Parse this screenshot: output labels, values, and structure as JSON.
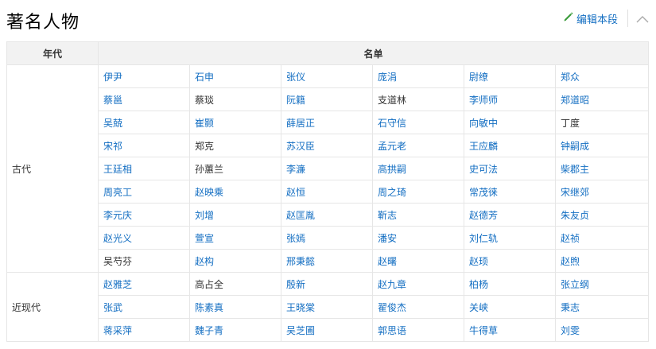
{
  "section": {
    "title": "著名人物",
    "edit_label": "编辑本段"
  },
  "table": {
    "headers": [
      "年代",
      "名单"
    ],
    "groups": [
      {
        "era": "古代",
        "rows": [
          [
            {
              "n": "伊尹",
              "l": true
            },
            {
              "n": "石申",
              "l": true
            },
            {
              "n": "张仪",
              "l": true
            },
            {
              "n": "庞涓",
              "l": true
            },
            {
              "n": "尉缭",
              "l": true
            },
            {
              "n": "郑众",
              "l": true
            }
          ],
          [
            {
              "n": "蔡邕",
              "l": true
            },
            {
              "n": "蔡琰",
              "l": false
            },
            {
              "n": "阮籍",
              "l": true
            },
            {
              "n": "支道林",
              "l": false
            },
            {
              "n": "李师师",
              "l": true
            },
            {
              "n": "郑道昭",
              "l": true
            }
          ],
          [
            {
              "n": "吴兢",
              "l": true
            },
            {
              "n": "崔颢",
              "l": true
            },
            {
              "n": "薛居正",
              "l": true
            },
            {
              "n": "石守信",
              "l": true
            },
            {
              "n": "向敏中",
              "l": true
            },
            {
              "n": "丁度",
              "l": false
            }
          ],
          [
            {
              "n": "宋祁",
              "l": true
            },
            {
              "n": "郑克",
              "l": false
            },
            {
              "n": "苏汉臣",
              "l": true
            },
            {
              "n": "孟元老",
              "l": true
            },
            {
              "n": "王应麟",
              "l": true
            },
            {
              "n": "钟嗣成",
              "l": true
            }
          ],
          [
            {
              "n": "王廷相",
              "l": true
            },
            {
              "n": "孙蕙兰",
              "l": false
            },
            {
              "n": "李濂",
              "l": true
            },
            {
              "n": "高拱嗣",
              "l": true
            },
            {
              "n": "史可法",
              "l": true
            },
            {
              "n": "柴郡主",
              "l": true
            }
          ],
          [
            {
              "n": "周亮工",
              "l": true
            },
            {
              "n": "赵映乘",
              "l": true
            },
            {
              "n": "赵恒",
              "l": true
            },
            {
              "n": "周之琦",
              "l": true
            },
            {
              "n": "常茂徕",
              "l": true
            },
            {
              "n": "宋继郊",
              "l": true
            }
          ],
          [
            {
              "n": "李元庆",
              "l": true
            },
            {
              "n": "刘增",
              "l": true
            },
            {
              "n": "赵匡胤",
              "l": true
            },
            {
              "n": "靳志",
              "l": true
            },
            {
              "n": "赵德芳",
              "l": true
            },
            {
              "n": "朱友贞",
              "l": true
            }
          ],
          [
            {
              "n": "赵光义",
              "l": true
            },
            {
              "n": "萱宣",
              "l": true
            },
            {
              "n": "张嫣",
              "l": true
            },
            {
              "n": "潘安",
              "l": true
            },
            {
              "n": "刘仁轨",
              "l": true
            },
            {
              "n": "赵祯",
              "l": true
            }
          ],
          [
            {
              "n": "吴芍芬",
              "l": false
            },
            {
              "n": "赵构",
              "l": true
            },
            {
              "n": "邢秉懿",
              "l": true
            },
            {
              "n": "赵曙",
              "l": true
            },
            {
              "n": "赵顼",
              "l": true
            },
            {
              "n": "赵煦",
              "l": true
            }
          ]
        ]
      },
      {
        "era": "近现代",
        "rows": [
          [
            {
              "n": "赵雅芝",
              "l": true
            },
            {
              "n": "高占全",
              "l": false
            },
            {
              "n": "殷新",
              "l": true
            },
            {
              "n": "赵九章",
              "l": true
            },
            {
              "n": "柏杨",
              "l": true
            },
            {
              "n": "张立纲",
              "l": true
            }
          ],
          [
            {
              "n": "张武",
              "l": true
            },
            {
              "n": "陈素真",
              "l": true
            },
            {
              "n": "王晓棠",
              "l": true
            },
            {
              "n": "翟俊杰",
              "l": true
            },
            {
              "n": "关峡",
              "l": true
            },
            {
              "n": "秉志",
              "l": true
            }
          ],
          [
            {
              "n": "蒋采萍",
              "l": true
            },
            {
              "n": "魏子青",
              "l": true
            },
            {
              "n": "吴芝圃",
              "l": true
            },
            {
              "n": "郭思语",
              "l": true
            },
            {
              "n": "牛得草",
              "l": true
            },
            {
              "n": "刘雯",
              "l": true
            }
          ]
        ]
      }
    ]
  },
  "colors": {
    "link": "#136ec2",
    "header_bg": "#f2f2f2",
    "border": "#e6e6e6",
    "edit_icon": "#3a9b3a"
  },
  "icons": {
    "edit": "pencil-icon",
    "collapse": "chevron-up-icon"
  }
}
